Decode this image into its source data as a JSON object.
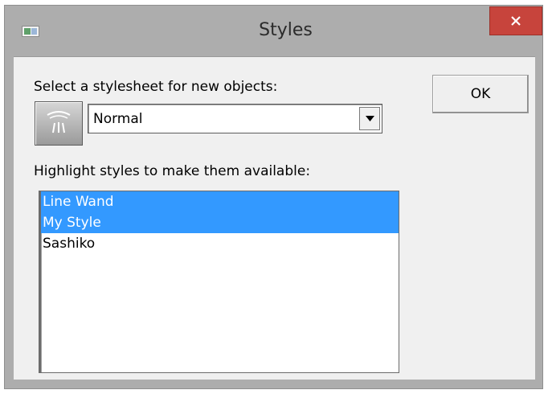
{
  "window": {
    "title": "Styles",
    "icon": "app-window-icon",
    "close_icon": "close-icon"
  },
  "dialog": {
    "stylesheet_label": "Select a stylesheet for new objects:",
    "stylesheet_icon": "style-brush-icon",
    "stylesheet_value": "Normal",
    "highlight_label": "Highlight styles to make them available:",
    "ok_label": "OK"
  },
  "styles_list": {
    "items": [
      {
        "label": "Line Wand",
        "selected": true
      },
      {
        "label": "My Style",
        "selected": true
      },
      {
        "label": "Sashiko",
        "selected": false
      }
    ]
  },
  "colors": {
    "selection": "#3399ff",
    "close_button": "#c7443c",
    "titlebar": "#adadad",
    "client": "#f0f0f0"
  }
}
